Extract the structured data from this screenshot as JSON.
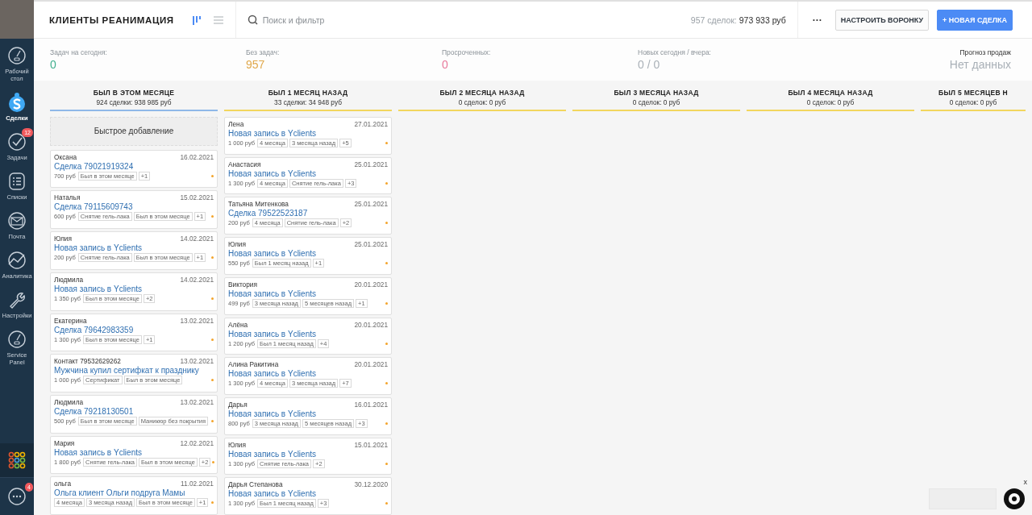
{
  "sidebar": {
    "items": [
      {
        "label": "Рабочий стол",
        "kind": "gauge",
        "selected": false
      },
      {
        "label": "Сделки",
        "kind": "deals",
        "selected": true
      },
      {
        "label": "Задачи",
        "kind": "check",
        "selected": false,
        "badge": "12"
      },
      {
        "label": "Списки",
        "kind": "list",
        "selected": false
      },
      {
        "label": "Почта",
        "kind": "mail",
        "selected": false
      },
      {
        "label": "Аналитика",
        "kind": "chart",
        "selected": false
      },
      {
        "label": "Настройки",
        "kind": "wrench",
        "selected": false
      },
      {
        "label": "Service Panel",
        "kind": "gauge",
        "selected": false
      }
    ],
    "chat_badge": "4"
  },
  "header": {
    "title": "КЛИЕНТЫ РЕАНИМАЦИЯ",
    "views": [
      {
        "kind": "pipeline",
        "selected": true
      },
      {
        "kind": "list",
        "selected": false
      }
    ],
    "search_placeholder": "Поиск и фильтр",
    "count_label": "957 сделок:",
    "count_sum": "973 933 руб",
    "more": "···",
    "buttons": [
      {
        "label": "НАСТРОИТЬ ВОРОНКУ",
        "kind": "secondary"
      },
      {
        "label": "+ НОВАЯ СДЕЛКА",
        "kind": "primary"
      }
    ]
  },
  "stats": [
    {
      "label": "Задач на сегодня:",
      "value": "0",
      "color": "#3fae8d"
    },
    {
      "label": "Без задач:",
      "value": "957",
      "color": "#e0a84b"
    },
    {
      "label": "Просроченных:",
      "value": "0",
      "color": "#e8789a"
    },
    {
      "label": "Новых сегодня / вчера:",
      "value": "0 / 0",
      "color": "#a9b0b7"
    }
  ],
  "forecast": {
    "label": "Прогноз продаж",
    "value": "Нет данных"
  },
  "columns": [
    {
      "title": "БЫЛ В ЭТОМ МЕСЯЦЕ",
      "summary": "924 сделки: 938 985 руб",
      "color": "#8fb8e8",
      "quick_add": "Быстрое добавление",
      "cards": [
        {
          "name": "Оксана",
          "date": "16.02.2021",
          "title": "Сделка 79021919324",
          "price": "700 руб",
          "tags": [
            "Был в этом месяце",
            "+1"
          ]
        },
        {
          "name": "Наталья",
          "date": "15.02.2021",
          "title": "Сделка 79115609743",
          "price": "600 руб",
          "tags": [
            "Снятие гель-лака",
            "Был в этом месяце",
            "+1"
          ]
        },
        {
          "name": "Юлия",
          "date": "14.02.2021",
          "title": "Новая запись в Yclients",
          "price": "200 руб",
          "tags": [
            "Снятие гель-лака",
            "Был в этом месяце",
            "+1"
          ]
        },
        {
          "name": "Людмила",
          "date": "14.02.2021",
          "title": "Новая запись в Yclients",
          "price": "1 350 руб",
          "tags": [
            "Был в этом месяце",
            "+2"
          ]
        },
        {
          "name": "Екатерина",
          "date": "13.02.2021",
          "title": "Сделка 79642983359",
          "price": "1 300 руб",
          "tags": [
            "Был в этом месяце",
            "+1"
          ]
        },
        {
          "name": "Контакт 79532629262",
          "date": "13.02.2021",
          "title": "Мужчина купил сертифкат к празднику",
          "price": "1 000 руб",
          "tags": [
            "Сертификат",
            "Был в этом месяце"
          ]
        },
        {
          "name": "Людмила",
          "date": "13.02.2021",
          "title": "Сделка 79218130501",
          "price": "500 руб",
          "tags": [
            "Был в этом месяце",
            "Маникюр без покрытия"
          ]
        },
        {
          "name": "Мария",
          "date": "12.02.2021",
          "title": "Новая запись в Yclients",
          "price": "1 800 руб",
          "tags": [
            "Снятие гель-лака",
            "Был в этом месяце",
            "+2"
          ]
        },
        {
          "name": "ольга",
          "date": "11.02.2021",
          "title": "Ольга клиент Ольги подруга Мамы",
          "tags": [
            "4 месяца",
            "3 месяца назад",
            "Был в этом месяце",
            "+1"
          ]
        }
      ]
    },
    {
      "title": "БЫЛ 1 МЕСЯЦ НАЗАД",
      "summary": "33 сделки: 34 948 руб",
      "color": "#f2d65e",
      "cards": [
        {
          "name": "Лена",
          "date": "27.01.2021",
          "title": "Новая запись в Yclients",
          "price": "1 000 руб",
          "tags": [
            "4 месяца",
            "3 месяца назад",
            "+5"
          ]
        },
        {
          "name": "Анастасия",
          "date": "25.01.2021",
          "title": "Новая запись в Yclients",
          "price": "1 300 руб",
          "tags": [
            "4 месяца",
            "Снятие гель-лака",
            "+3"
          ]
        },
        {
          "name": "Татьяна Митенкова",
          "date": "25.01.2021",
          "title": "Сделка 79522523187",
          "price": "200 руб",
          "tags": [
            "4 месяца",
            "Снятие гель-лака",
            "+2"
          ]
        },
        {
          "name": "Юлия",
          "date": "25.01.2021",
          "title": "Новая запись в Yclients",
          "price": "550 руб",
          "tags": [
            "Был 1 месяц назад",
            "+1"
          ]
        },
        {
          "name": "Виктория",
          "date": "20.01.2021",
          "title": "Новая запись в Yclients",
          "price": "499 руб",
          "tags": [
            "3 месяца назад",
            "5 месяцев назад",
            "+1"
          ]
        },
        {
          "name": "Алёна",
          "date": "20.01.2021",
          "title": "Новая запись в Yclients",
          "price": "1 200 руб",
          "tags": [
            "Был 1 месяц назад",
            "+4"
          ]
        },
        {
          "name": "Алина Ракитина",
          "date": "20.01.2021",
          "title": "Новая запись в Yclients",
          "price": "1 300 руб",
          "tags": [
            "4 месяца",
            "3 месяца назад",
            "+7"
          ]
        },
        {
          "name": "Дарья",
          "date": "16.01.2021",
          "title": "Новая запись в Yclients",
          "price": "800 руб",
          "tags": [
            "3 месяца назад",
            "5 месяцев назад",
            "+3"
          ]
        },
        {
          "name": "Юлия",
          "date": "15.01.2021",
          "title": "Новая запись в Yclients",
          "price": "1 300 руб",
          "tags": [
            "Снятие гель-лака",
            "+2"
          ]
        },
        {
          "name": "Дарья Степанова",
          "date": "30.12.2020",
          "title": "Новая запись в Yclients",
          "price": "1 300 руб",
          "tags": [
            "Был 1 месяц назад",
            "+3"
          ]
        }
      ]
    },
    {
      "title": "БЫЛ 2 МЕСЯЦА НАЗАД",
      "summary": "0 сделок: 0 руб",
      "color": "#f2d65e"
    },
    {
      "title": "БЫЛ 3 МЕСЯЦА НАЗАД",
      "summary": "0 сделок: 0 руб",
      "color": "#f2d65e"
    },
    {
      "title": "БЫЛ 4 МЕСЯЦА НАЗАД",
      "summary": "0 сделок: 0 руб",
      "color": "#f2d65e"
    },
    {
      "title": "БЫЛ 5 МЕСЯЦЕВ Н",
      "summary": "0 сделок: 0 руб",
      "color": "#f2d65e"
    }
  ],
  "chat_widget": {
    "close": "x"
  }
}
